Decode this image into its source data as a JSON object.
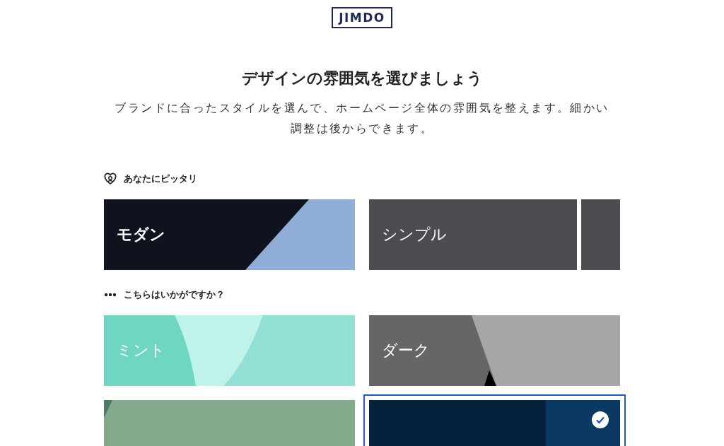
{
  "logo": "JIMDO",
  "title": "デザインの雰囲気を選びましょう",
  "description": "ブランドに合ったスタイルを選んで、ホームページ全体の雰囲気を整えます。細かい調整は後からできます。",
  "sections": [
    {
      "kind": "match",
      "heading": "あなたにピッタリ",
      "cards": [
        {
          "kind": "modern",
          "label": "モダン",
          "selected": false
        },
        {
          "kind": "simple",
          "label": "シンプル",
          "selected": false
        }
      ]
    },
    {
      "kind": "more",
      "heading": "こちらはいかがですか？",
      "cards": [
        {
          "kind": "mint",
          "label": "ミント",
          "selected": false
        },
        {
          "kind": "dark",
          "label": "ダーク",
          "selected": false
        },
        {
          "kind": "green",
          "selected": false
        },
        {
          "kind": "navy",
          "selected": true
        }
      ]
    }
  ]
}
